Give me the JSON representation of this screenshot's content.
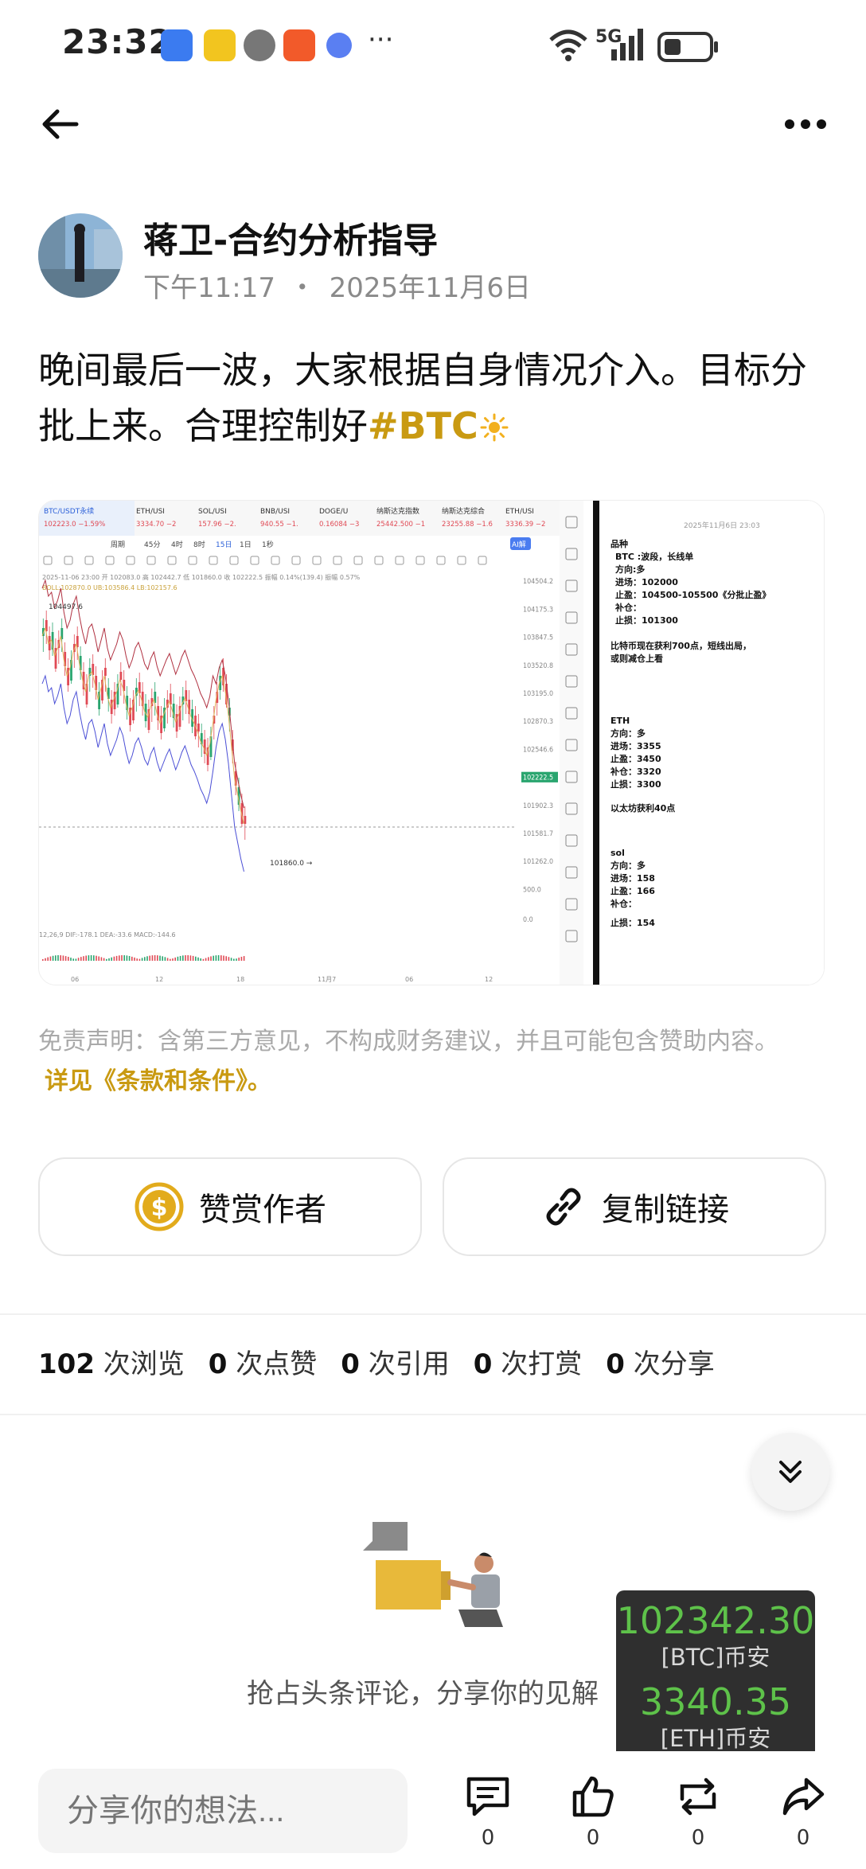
{
  "status_bar": {
    "time": "23:32",
    "network": "5G",
    "more": "···"
  },
  "author": {
    "name": "蒋卫-合约分析指导",
    "time": "下午11:17",
    "separator": "・",
    "date": "2025年11月6日"
  },
  "post": {
    "text_main": "晚间最后一波，大家根据自身情况介入。目标分批上来。合理控制好",
    "hashtag": "#BTC"
  },
  "chart_image": {
    "tabs": [
      "BTC/USDT永续",
      "ETH/USI",
      "SOL/USI",
      "BNB/USI",
      "DOGE/U",
      "纳斯达克指数",
      "纳斯达克综合",
      "ETH/USI"
    ],
    "tab_prices": [
      "102223.0 −1.59%",
      "3334.70 −2",
      "157.96 −2.",
      "940.55 −1.",
      "0.16084 −3",
      "25442.500 −1",
      "23255.88 −1.6",
      "3336.39 −2"
    ],
    "toolbar": [
      "周期",
      "45分",
      "4时",
      "8时",
      "15日",
      "1日",
      "1秒"
    ],
    "ohlc_line": "2025-11-06 23:00  开 102083.0  高 102442.7  低 101860.0  收 102222.5  振幅 0.14%(139.4)  振幅 0.57%",
    "boll_line": "BOLL:102870.0  UB:103586.4  LB:102157.6",
    "price_axis": [
      "104504.2",
      "104175.3",
      "103847.5",
      "103520.8",
      "103195.0",
      "102870.3",
      "102546.6",
      "102222.5",
      "101902.3",
      "101581.7",
      "101262.0",
      "500.0",
      "0.0"
    ],
    "high_marker": "104497.6",
    "low_marker": "101860.0 →",
    "macd_line": "12,26,9  DIF:-178.1  DEA:-33.6  MACD:-144.6",
    "x_axis": [
      "06",
      "12",
      "18",
      "11月7",
      "06",
      "12"
    ],
    "note_header": "2025年11月6日 23:03",
    "note_lines": [
      "品种",
      "BTC :波段，长线单",
      "方向:多",
      "进场：102000",
      "止盈：104500-105500《分批止盈》",
      "补仓：",
      "止损：101300",
      "比特币现在获利700点，短线出局，",
      "或则减仓上看",
      "ETH",
      "方向：多",
      "进场：3355",
      "止盈：3450",
      "补仓：3320",
      "止损：3300",
      "以太坊获利40点",
      "sol",
      "方向：多",
      "进场：158",
      "止盈：166",
      "补仓：",
      "止损：154"
    ]
  },
  "disclaimer": {
    "text": "免责声明：含第三方意见，不构成财务建议，并且可能包含赞助内容。",
    "link": "详见《条款和条件》。"
  },
  "actions": {
    "tip_label": "赞赏作者",
    "copy_label": "复制链接"
  },
  "stats": {
    "views": "102",
    "views_label": "次浏览",
    "likes": "0",
    "likes_label": "次点赞",
    "quotes": "0",
    "quotes_label": "次引用",
    "tips": "0",
    "tips_label": "次打赏",
    "shares": "0",
    "shares_label": "次分享"
  },
  "comments": {
    "empty_text": "抢占头条评论，分享你的见解",
    "input_placeholder": "分享你的想法..."
  },
  "ticker": {
    "btc_price": "102342.30",
    "btc_label": "[BTC]币安",
    "eth_price": "3340.35",
    "eth_label": "[ETH]币安"
  },
  "bottom_bar": {
    "comment_count": "0",
    "like_count": "0",
    "repost_count": "0",
    "share_count": "0"
  },
  "colors": {
    "accent": "#c99a12",
    "ticker_green": "#5ec24a",
    "candle_red": "#e04a55",
    "candle_green": "#2aa56f"
  }
}
